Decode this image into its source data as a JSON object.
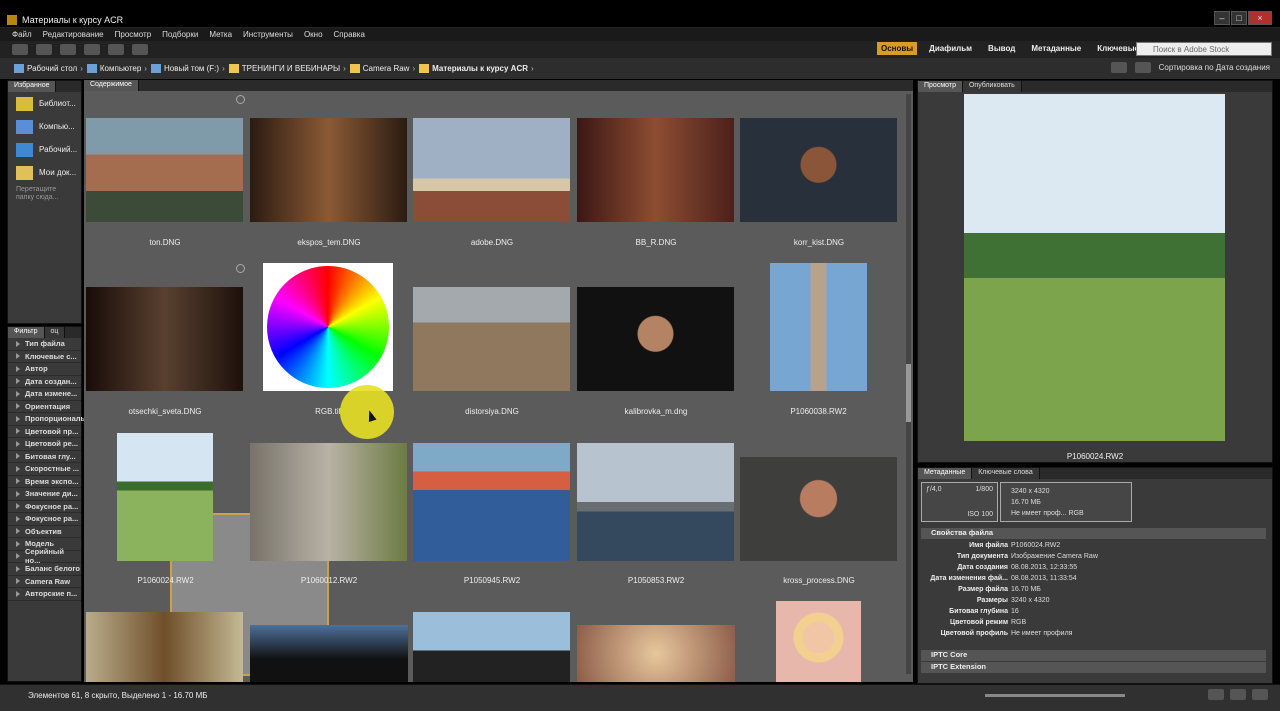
{
  "window": {
    "title": "Материалы к курсу ACR"
  },
  "menu": [
    "Файл",
    "Редактирование",
    "Просмотр",
    "Подборки",
    "Метка",
    "Инструменты",
    "Окно",
    "Справка"
  ],
  "workspaces": [
    "Основы",
    "Диафильм",
    "Вывод",
    "Метаданные",
    "Ключевые"
  ],
  "search": {
    "placeholder": "Поиск в Adobe Stock"
  },
  "breadcrumbs": [
    "Рабочий стол",
    "Компьютер",
    "Новый том (F:)",
    "ТРЕНИНГИ И ВЕБИНАРЫ",
    "Camera Raw",
    "Материалы к курсу ACR"
  ],
  "sort": "Сортировка по Дата создания",
  "favorites": {
    "tab": "Избранное",
    "items": [
      "Библиот...",
      "Компью...",
      "Рабочий...",
      "Мои док..."
    ],
    "hint": "Перетащите папку сюда..."
  },
  "filter": {
    "tabs": [
      "Фильтр",
      "оц"
    ],
    "items": [
      "Тип файла",
      "Ключевые с...",
      "Автор",
      "Дата создан...",
      "Дата измене...",
      "Ориентация",
      "Пропорциональ...",
      "Цветовой пр...",
      "Цветовой ре...",
      "Битовая глу...",
      "Скоростные ...",
      "Время экспо...",
      "Значение ди...",
      "Фокусное ра...",
      "Фокусное ра...",
      "Объектив",
      "Модель",
      "Серийный но...",
      "Баланс белого",
      "Camera Raw",
      "Авторские п..."
    ]
  },
  "content": {
    "tab": "Содержимое",
    "thumbnails": [
      {
        "name": "ton.DNG"
      },
      {
        "name": "ekspos_tem.DNG"
      },
      {
        "name": "adobe.DNG"
      },
      {
        "name": "BB_R.DNG"
      },
      {
        "name": "korr_kist.DNG"
      },
      {
        "name": "otsechki_sveta.DNG"
      },
      {
        "name": "RGB.tif"
      },
      {
        "name": "distorsiya.DNG"
      },
      {
        "name": "kalibrovka_m.dng"
      },
      {
        "name": "P1060038.RW2"
      },
      {
        "name": "P1060024.RW2"
      },
      {
        "name": "P1060012.RW2"
      },
      {
        "name": "P1050945.RW2"
      },
      {
        "name": "P1050853.RW2"
      },
      {
        "name": "kross_process.DNG"
      }
    ]
  },
  "preview": {
    "tabs": [
      "Просмотр",
      "Опубликовать"
    ],
    "caption": "P1060024.RW2"
  },
  "metadata": {
    "tabs": [
      "Метаданные",
      "Ключевые слова"
    ],
    "camera": {
      "aperture": "ƒ/4,0",
      "shutter": "1/800",
      "iso": "ISO 100",
      "dimensions": "3240 x 4320",
      "size": "16.70 МБ",
      "profile": "Не имеет проф...",
      "mode": "RGB"
    },
    "section": "Свойства файла",
    "properties": [
      {
        "key": "Имя файла",
        "value": "P1060024.RW2"
      },
      {
        "key": "Тип документа",
        "value": "Изображение Camera Raw"
      },
      {
        "key": "Дата создания",
        "value": "08.08.2013, 12:33:55"
      },
      {
        "key": "Дата изменения фай...",
        "value": "08.08.2013, 11:33:54"
      },
      {
        "key": "Размер файла",
        "value": "16.70 МБ"
      },
      {
        "key": "Размеры",
        "value": "3240 x 4320"
      },
      {
        "key": "Битовая глубина",
        "value": "16"
      },
      {
        "key": "Цветовой режим",
        "value": "RGB"
      },
      {
        "key": "Цветовой профиль",
        "value": "Не имеет профиля"
      }
    ],
    "sections": [
      "IPTC Core",
      "IPTC Extension"
    ]
  },
  "status": "Элементов 61, 8 скрыто, Выделено 1 - 16.70 МБ"
}
